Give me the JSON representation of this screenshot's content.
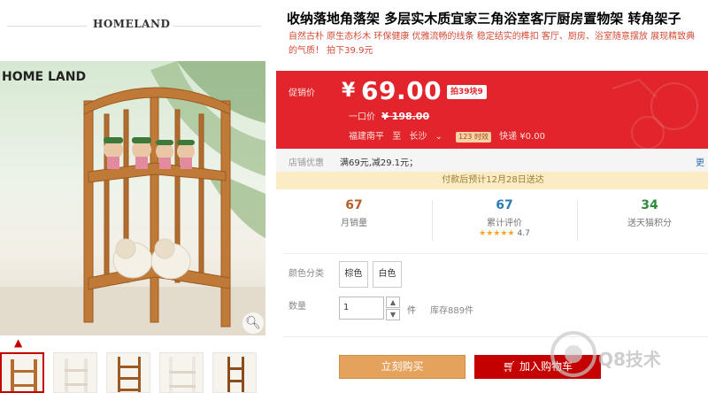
{
  "brand": {
    "header_name": "HOMELAND",
    "image_brand": "HOME LAND"
  },
  "gallery": {
    "zoom_icon": "magnifier-icon",
    "up_icon": "chevron-up-icon",
    "thumb_count": 5
  },
  "product": {
    "title": "收纳落地角落架 多层实木质宜家三角浴室客厅厨房置物架 转角架子",
    "subtitle_line1": "自然古朴 原生态杉木 环保健康 优雅流畅的线条 稳定结实的榫扣 客厅、厨房、浴室随意摆放 展现精致典",
    "subtitle_line2": "的气质！ 拍下39.9元"
  },
  "price": {
    "label": "促销价",
    "currency": "¥",
    "value": "69.00",
    "deal_badge": "拍39块9",
    "orig_label": "一口价",
    "orig_price": "¥ 198.00",
    "ship_from": "福建南平",
    "ship_to_word": "至",
    "ship_dest": "长沙",
    "time_badge": "123 时效",
    "delivery": "快递 ¥0.00"
  },
  "shop": {
    "label": "店铺优惠",
    "value": "满69元,减29.1元；",
    "more": "更"
  },
  "notice": "付款后预计12月28日送达",
  "stats": [
    {
      "num": "67",
      "label": "月销量",
      "color": "#b5602a"
    },
    {
      "num": "67",
      "label": "累计评价",
      "color": "#2a7bb5",
      "stars": "★★★★★",
      "rating": "4.7"
    },
    {
      "num": "34",
      "label": "送天猫积分",
      "color": "#2e8b3e"
    }
  ],
  "options": {
    "color_label": "颜色分类",
    "colors": [
      "棕色",
      "白色"
    ],
    "qty_label": "数量",
    "qty_value": "1",
    "unit": "件",
    "stock": "库存889件"
  },
  "actions": {
    "buy": "立刻购买",
    "cart": "加入购物车"
  },
  "watermark": "Q8技术"
}
